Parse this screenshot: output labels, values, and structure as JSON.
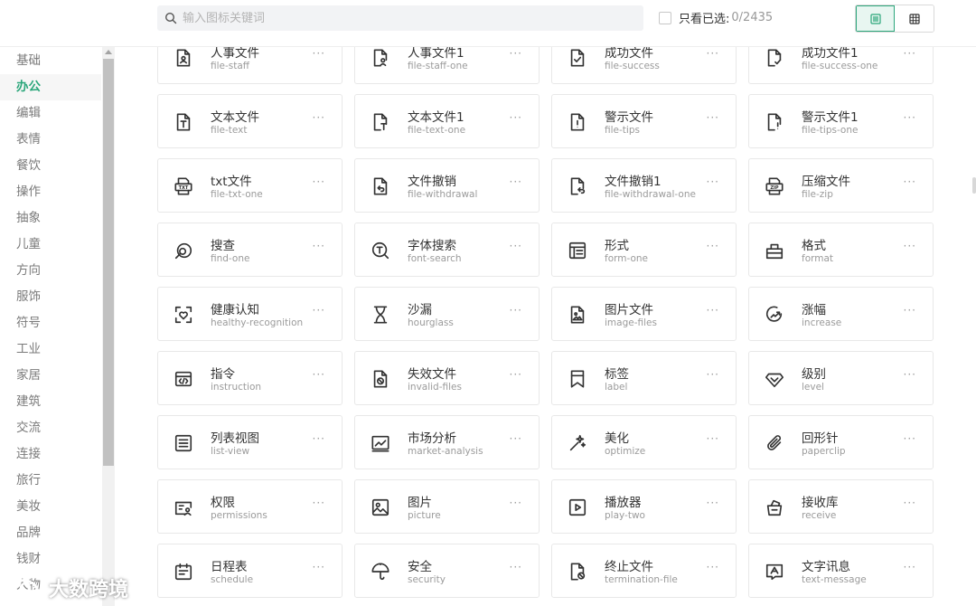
{
  "search": {
    "placeholder": "输入图标关键词"
  },
  "filter": {
    "label": "只看已选:",
    "count": "0/2435"
  },
  "colors": {
    "accent": "#2aa67a",
    "card_border": "#e8e8e8"
  },
  "sidebar": {
    "items": [
      {
        "label": "基础"
      },
      {
        "label": "办公",
        "active": true
      },
      {
        "label": "编辑"
      },
      {
        "label": "表情"
      },
      {
        "label": "餐饮"
      },
      {
        "label": "操作"
      },
      {
        "label": "抽象"
      },
      {
        "label": "儿童"
      },
      {
        "label": "方向"
      },
      {
        "label": "服饰"
      },
      {
        "label": "符号"
      },
      {
        "label": "工业"
      },
      {
        "label": "家居"
      },
      {
        "label": "建筑"
      },
      {
        "label": "交流"
      },
      {
        "label": "连接"
      },
      {
        "label": "旅行"
      },
      {
        "label": "美妆"
      },
      {
        "label": "品牌"
      },
      {
        "label": "钱财"
      },
      {
        "label": "人物"
      }
    ]
  },
  "icons": [
    {
      "name": "人事文件",
      "key": "file-staff",
      "icon": "file-person-icon"
    },
    {
      "name": "人事文件1",
      "key": "file-staff-one",
      "icon": "file-person-outline-icon"
    },
    {
      "name": "成功文件",
      "key": "file-success",
      "icon": "file-check-icon"
    },
    {
      "name": "成功文件1",
      "key": "file-success-one",
      "icon": "file-check-outline-icon"
    },
    {
      "name": "文本文件",
      "key": "file-text",
      "icon": "file-text-icon"
    },
    {
      "name": "文本文件1",
      "key": "file-text-one",
      "icon": "file-text-outline-icon"
    },
    {
      "name": "警示文件",
      "key": "file-tips",
      "icon": "file-alert-icon"
    },
    {
      "name": "警示文件1",
      "key": "file-tips-one",
      "icon": "file-alert-outline-icon"
    },
    {
      "name": "txt文件",
      "key": "file-txt-one",
      "icon": "file-txt-icon"
    },
    {
      "name": "文件撤销",
      "key": "file-withdrawal",
      "icon": "file-undo-icon"
    },
    {
      "name": "文件撤销1",
      "key": "file-withdrawal-one",
      "icon": "file-undo-outline-icon"
    },
    {
      "name": "压缩文件",
      "key": "file-zip",
      "icon": "file-zip-icon"
    },
    {
      "name": "搜查",
      "key": "find-one",
      "icon": "find-icon"
    },
    {
      "name": "字体搜索",
      "key": "font-search",
      "icon": "font-search-icon"
    },
    {
      "name": "形式",
      "key": "form-one",
      "icon": "form-icon"
    },
    {
      "name": "格式",
      "key": "format",
      "icon": "format-icon"
    },
    {
      "name": "健康认知",
      "key": "healthy-recognition",
      "icon": "healthy-recognition-icon"
    },
    {
      "name": "沙漏",
      "key": "hourglass",
      "icon": "hourglass-icon"
    },
    {
      "name": "图片文件",
      "key": "image-files",
      "icon": "image-file-icon"
    },
    {
      "name": "涨幅",
      "key": "increase",
      "icon": "increase-icon"
    },
    {
      "name": "指令",
      "key": "instruction",
      "icon": "instruction-icon"
    },
    {
      "name": "失效文件",
      "key": "invalid-files",
      "icon": "invalid-file-icon"
    },
    {
      "name": "标签",
      "key": "label",
      "icon": "bookmark-icon"
    },
    {
      "name": "级别",
      "key": "level",
      "icon": "diamond-icon"
    },
    {
      "name": "列表视图",
      "key": "list-view",
      "icon": "list-view-icon"
    },
    {
      "name": "市场分析",
      "key": "market-analysis",
      "icon": "market-analysis-icon"
    },
    {
      "name": "美化",
      "key": "optimize",
      "icon": "magic-wand-icon"
    },
    {
      "name": "回形针",
      "key": "paperclip",
      "icon": "paperclip-icon"
    },
    {
      "name": "权限",
      "key": "permissions",
      "icon": "permissions-icon"
    },
    {
      "name": "图片",
      "key": "picture",
      "icon": "picture-icon"
    },
    {
      "name": "播放器",
      "key": "play-two",
      "icon": "play-icon"
    },
    {
      "name": "接收库",
      "key": "receive",
      "icon": "receive-icon"
    },
    {
      "name": "日程表",
      "key": "schedule",
      "icon": "schedule-icon"
    },
    {
      "name": "安全",
      "key": "security",
      "icon": "umbrella-icon"
    },
    {
      "name": "终止文件",
      "key": "termination-file",
      "icon": "termination-file-icon"
    },
    {
      "name": "文字讯息",
      "key": "text-message",
      "icon": "text-message-icon"
    }
  ],
  "more_label": "···",
  "watermark": {
    "text": "大数跨境"
  }
}
